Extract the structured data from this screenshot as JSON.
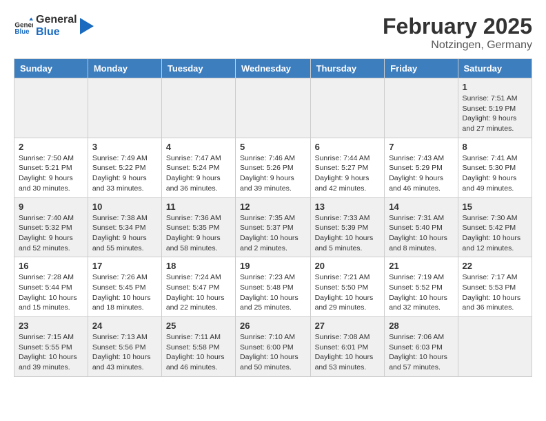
{
  "header": {
    "logo_general": "General",
    "logo_blue": "Blue",
    "month": "February 2025",
    "location": "Notzingen, Germany"
  },
  "weekdays": [
    "Sunday",
    "Monday",
    "Tuesday",
    "Wednesday",
    "Thursday",
    "Friday",
    "Saturday"
  ],
  "weeks": [
    [
      {
        "day": "",
        "info": ""
      },
      {
        "day": "",
        "info": ""
      },
      {
        "day": "",
        "info": ""
      },
      {
        "day": "",
        "info": ""
      },
      {
        "day": "",
        "info": ""
      },
      {
        "day": "",
        "info": ""
      },
      {
        "day": "1",
        "info": "Sunrise: 7:51 AM\nSunset: 5:19 PM\nDaylight: 9 hours and 27 minutes."
      }
    ],
    [
      {
        "day": "2",
        "info": "Sunrise: 7:50 AM\nSunset: 5:21 PM\nDaylight: 9 hours and 30 minutes."
      },
      {
        "day": "3",
        "info": "Sunrise: 7:49 AM\nSunset: 5:22 PM\nDaylight: 9 hours and 33 minutes."
      },
      {
        "day": "4",
        "info": "Sunrise: 7:47 AM\nSunset: 5:24 PM\nDaylight: 9 hours and 36 minutes."
      },
      {
        "day": "5",
        "info": "Sunrise: 7:46 AM\nSunset: 5:26 PM\nDaylight: 9 hours and 39 minutes."
      },
      {
        "day": "6",
        "info": "Sunrise: 7:44 AM\nSunset: 5:27 PM\nDaylight: 9 hours and 42 minutes."
      },
      {
        "day": "7",
        "info": "Sunrise: 7:43 AM\nSunset: 5:29 PM\nDaylight: 9 hours and 46 minutes."
      },
      {
        "day": "8",
        "info": "Sunrise: 7:41 AM\nSunset: 5:30 PM\nDaylight: 9 hours and 49 minutes."
      }
    ],
    [
      {
        "day": "9",
        "info": "Sunrise: 7:40 AM\nSunset: 5:32 PM\nDaylight: 9 hours and 52 minutes."
      },
      {
        "day": "10",
        "info": "Sunrise: 7:38 AM\nSunset: 5:34 PM\nDaylight: 9 hours and 55 minutes."
      },
      {
        "day": "11",
        "info": "Sunrise: 7:36 AM\nSunset: 5:35 PM\nDaylight: 9 hours and 58 minutes."
      },
      {
        "day": "12",
        "info": "Sunrise: 7:35 AM\nSunset: 5:37 PM\nDaylight: 10 hours and 2 minutes."
      },
      {
        "day": "13",
        "info": "Sunrise: 7:33 AM\nSunset: 5:39 PM\nDaylight: 10 hours and 5 minutes."
      },
      {
        "day": "14",
        "info": "Sunrise: 7:31 AM\nSunset: 5:40 PM\nDaylight: 10 hours and 8 minutes."
      },
      {
        "day": "15",
        "info": "Sunrise: 7:30 AM\nSunset: 5:42 PM\nDaylight: 10 hours and 12 minutes."
      }
    ],
    [
      {
        "day": "16",
        "info": "Sunrise: 7:28 AM\nSunset: 5:44 PM\nDaylight: 10 hours and 15 minutes."
      },
      {
        "day": "17",
        "info": "Sunrise: 7:26 AM\nSunset: 5:45 PM\nDaylight: 10 hours and 18 minutes."
      },
      {
        "day": "18",
        "info": "Sunrise: 7:24 AM\nSunset: 5:47 PM\nDaylight: 10 hours and 22 minutes."
      },
      {
        "day": "19",
        "info": "Sunrise: 7:23 AM\nSunset: 5:48 PM\nDaylight: 10 hours and 25 minutes."
      },
      {
        "day": "20",
        "info": "Sunrise: 7:21 AM\nSunset: 5:50 PM\nDaylight: 10 hours and 29 minutes."
      },
      {
        "day": "21",
        "info": "Sunrise: 7:19 AM\nSunset: 5:52 PM\nDaylight: 10 hours and 32 minutes."
      },
      {
        "day": "22",
        "info": "Sunrise: 7:17 AM\nSunset: 5:53 PM\nDaylight: 10 hours and 36 minutes."
      }
    ],
    [
      {
        "day": "23",
        "info": "Sunrise: 7:15 AM\nSunset: 5:55 PM\nDaylight: 10 hours and 39 minutes."
      },
      {
        "day": "24",
        "info": "Sunrise: 7:13 AM\nSunset: 5:56 PM\nDaylight: 10 hours and 43 minutes."
      },
      {
        "day": "25",
        "info": "Sunrise: 7:11 AM\nSunset: 5:58 PM\nDaylight: 10 hours and 46 minutes."
      },
      {
        "day": "26",
        "info": "Sunrise: 7:10 AM\nSunset: 6:00 PM\nDaylight: 10 hours and 50 minutes."
      },
      {
        "day": "27",
        "info": "Sunrise: 7:08 AM\nSunset: 6:01 PM\nDaylight: 10 hours and 53 minutes."
      },
      {
        "day": "28",
        "info": "Sunrise: 7:06 AM\nSunset: 6:03 PM\nDaylight: 10 hours and 57 minutes."
      },
      {
        "day": "",
        "info": ""
      }
    ]
  ]
}
